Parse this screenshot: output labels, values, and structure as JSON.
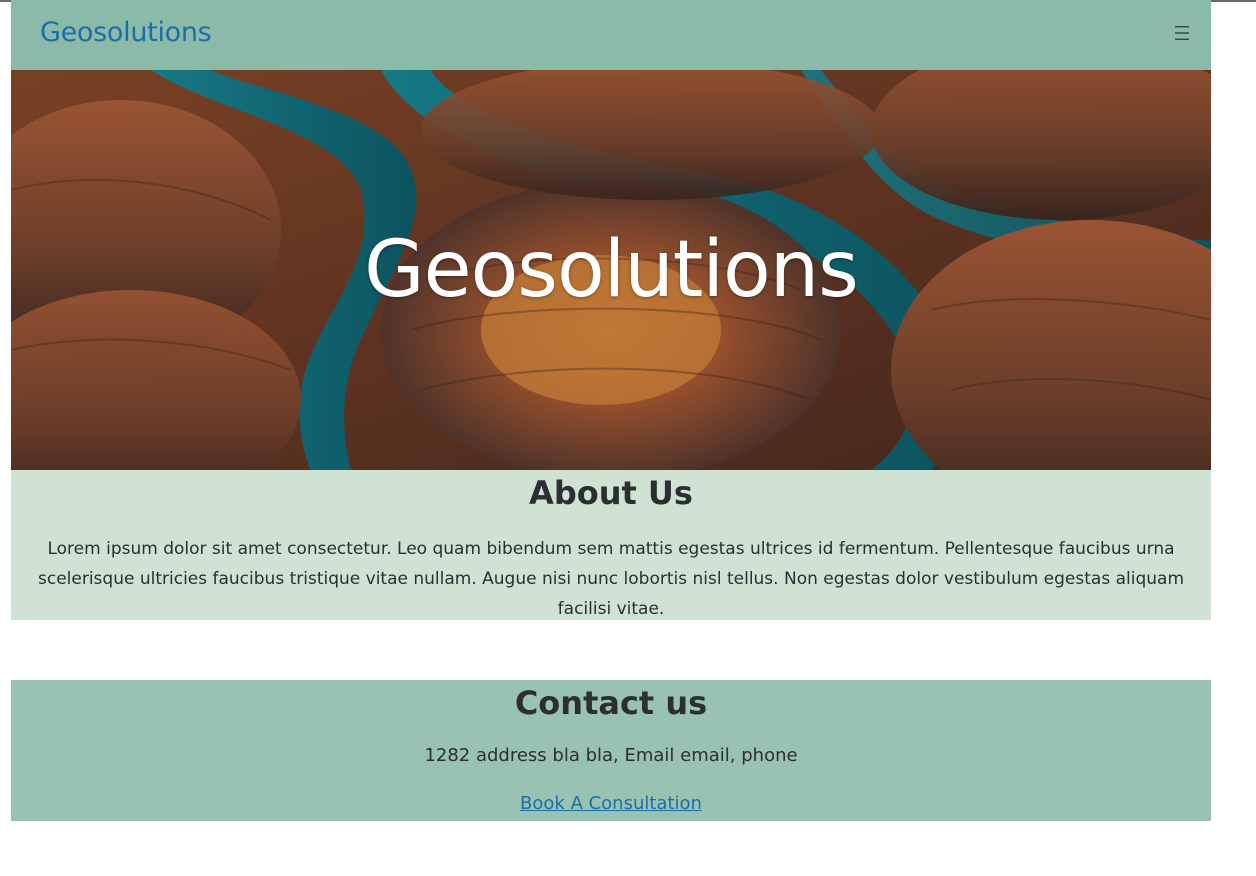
{
  "navbar": {
    "brand": "Geosolutions",
    "menu_icon": "hamburger-menu-icon"
  },
  "hero": {
    "title": "Geosolutions",
    "image": "canyon-river-aerial-image"
  },
  "about": {
    "heading": "About Us",
    "body": "Lorem ipsum dolor sit amet consectetur. Leo quam bibendum sem mattis egestas ultrices id fermentum. Pellentesque faucibus urna scelerisque ultricies faucibus tristique vitae nullam. Augue nisi nunc lobortis nisl tellus. Non egestas dolor vestibulum egestas aliquam facilisi vitae."
  },
  "contact": {
    "heading": "Contact us",
    "address": "1282 address bla bla, Email email, phone",
    "cta_label": "Book A Consultation"
  },
  "colors": {
    "navbar_bg": "#8cbaa9",
    "about_bg": "#cfe2d4",
    "contact_bg": "#99c2b3",
    "link": "#1a6fa8",
    "text": "#2b2f33"
  }
}
